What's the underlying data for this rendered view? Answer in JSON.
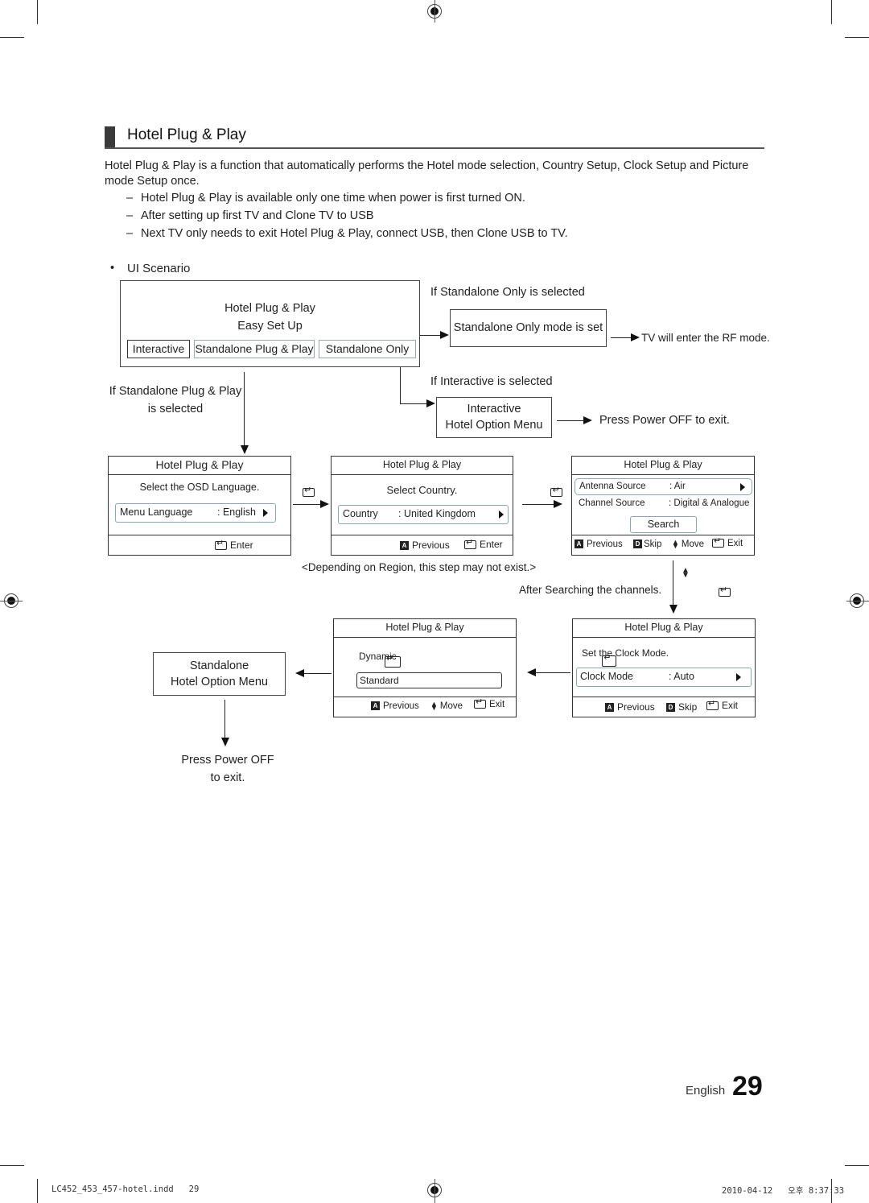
{
  "section": {
    "title": "Hotel Plug & Play",
    "intro": "Hotel Plug & Play is a function that automatically performs the Hotel mode selection, Country Setup, Clock Setup and Picture mode Setup once.",
    "bullets": [
      "Hotel Plug & Play is available only one time when power is first turned ON.",
      "After setting up first TV and Clone TV to USB",
      "Next TV only needs to exit Hotel Plug & Play, connect USB, then Clone USB to TV."
    ],
    "dash": "–"
  },
  "scenario": {
    "heading": "UI Scenario",
    "bullet": "•",
    "start_box": {
      "line1": "Hotel Plug & Play",
      "line2": "Easy Set Up",
      "options": [
        "Interactive",
        "Standalone Plug & Play",
        "Standalone Only"
      ]
    },
    "standalone_only": {
      "condition": "If Standalone Only is selected",
      "box": "Standalone Only mode is set",
      "result": "TV will enter the RF mode."
    },
    "interactive": {
      "condition": "If Interactive is selected",
      "box_line1": "Interactive",
      "box_line2": "Hotel Option Menu",
      "result": "Press Power OFF to exit."
    },
    "standalone_pnp_condition_line1": "If Standalone Plug & Play",
    "standalone_pnp_condition_line2": "is selected",
    "screens": {
      "language": {
        "header": "Hotel Plug & Play",
        "prompt": "Select the OSD Language.",
        "field_label": "Menu Language",
        "field_value": ": English",
        "footer": {
          "enter": "Enter"
        }
      },
      "country": {
        "header": "Hotel Plug & Play",
        "prompt": "Select Country.",
        "field_label": "Country",
        "field_value": ": United Kingdom",
        "footer": {
          "prev_key": "A",
          "previous": "Previous",
          "enter": "Enter"
        }
      },
      "channels": {
        "header": "Hotel Plug & Play",
        "row1_label": "Antenna Source",
        "row1_value": ": Air",
        "row2_label": "Channel Source",
        "row2_value": ": Digital & Analogue",
        "search_button": "Search",
        "footer": {
          "prev_key": "A",
          "previous": "Previous",
          "skip_key": "D",
          "skip": "Skip",
          "move": "Move",
          "exit": "Exit"
        }
      },
      "clock": {
        "header": "Hotel Plug & Play",
        "prompt": "Set the Clock Mode.",
        "field_label": "Clock Mode",
        "field_value": ": Auto",
        "footer": {
          "prev_key": "A",
          "previous": "Previous",
          "skip_key": "D",
          "skip": "Skip",
          "exit": "Exit"
        }
      },
      "picture": {
        "header": "Hotel Plug & Play",
        "option1": "Dynamic",
        "option2": "Standard",
        "footer": {
          "prev_key": "A",
          "previous": "Previous",
          "move": "Move",
          "exit": "Exit"
        }
      }
    },
    "region_note": "<Depending on Region, this step may not exist.>",
    "after_search": "After Searching the channels.",
    "standalone_menu": {
      "line1": "Standalone",
      "line2": "Hotel Option Menu"
    },
    "final_line1": "Press Power OFF",
    "final_line2": "to exit."
  },
  "footer": {
    "language": "English",
    "page_number": "29",
    "slug_left": "LC452_453_457-hotel.indd   29",
    "slug_right": "2010-04-12   오후 8:37:33"
  }
}
